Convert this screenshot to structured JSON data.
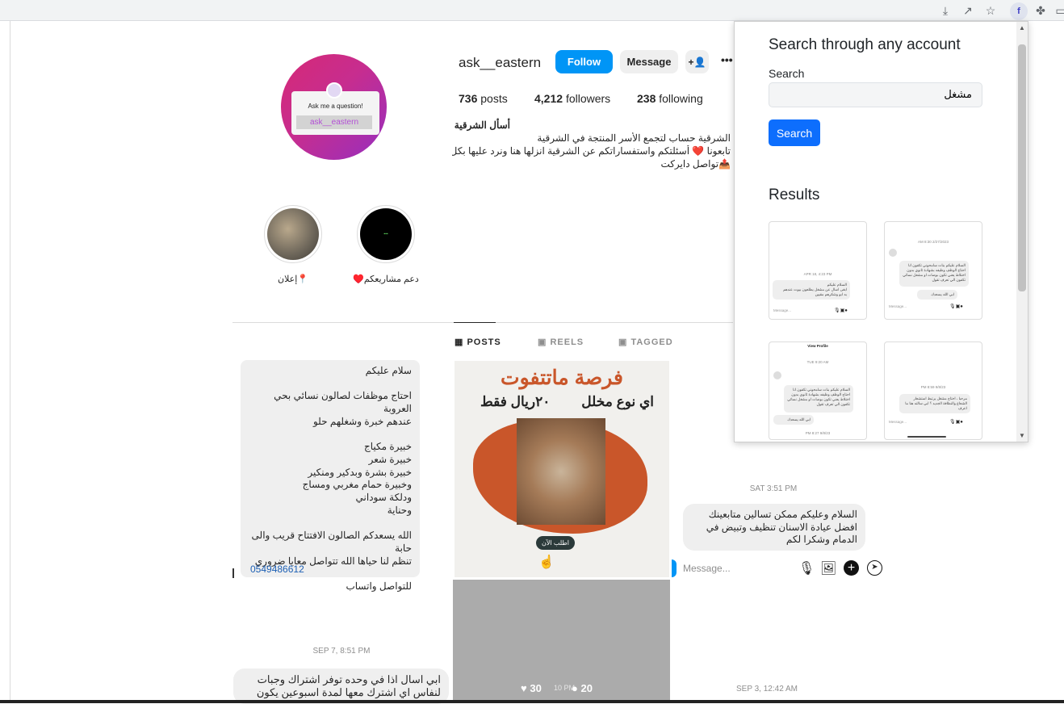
{
  "profile": {
    "username": "ask__eastern",
    "follow_label": "Follow",
    "message_label": "Message",
    "more_label": "•••",
    "posts_count": "736",
    "posts_label": "posts",
    "followers_count": "4,212",
    "followers_label": "followers",
    "following_count": "238",
    "following_label": "following",
    "display_name": "أسأل الشرقية",
    "bio_line1": "الشرقية حساب لتجمع الأسر المنتجة في الشرقية",
    "bio_line2": "تابعونا ❤️ أسئلتكم واستفساراتكم عن الشرقية انزلها هنا ونرد عليها بكل حب",
    "bio_line3": "📤تواصل دايركت",
    "avatar_caption": "Ask me a question!",
    "avatar_tag": "ask__eastern"
  },
  "highlights": [
    {
      "label": "📍إعلان"
    },
    {
      "label": "دعم مشاريعكم♥️"
    }
  ],
  "tabs": [
    {
      "label": "POSTS",
      "icon": "grid-icon"
    },
    {
      "label": "REELS",
      "icon": "reels-icon"
    },
    {
      "label": "TAGGED",
      "icon": "tagged-icon"
    }
  ],
  "posts": {
    "post1_text": "سلام عليكم\n\nاحتاج موظفات لصالون نسائي بحي العروبة\nعندهم خبرة وشغلهم حلو\n\nخبيرة مكياج\nخبيرة شعر\nخبيرة بشرة وبدكير ومنكير\nوخبيرة حمام مغربي ومساج\nودلكة سوداني\nوحناية\n\nالله يسعدكم الصالون الافتتاح قريب والى حابة\nتنظم لنا حياها الله  تتواصل معايا ضروري\n\nللتواصل واتساب",
    "post1_phone": "0549486612",
    "promo_title": "فرصة ماتتفوت",
    "promo_sub1": "اي نوع مخلل",
    "promo_sub2": "٢٠ريال فقط",
    "promo_button": "اطلب الآن",
    "post3_time": "SAT 3:51 PM",
    "post3_text": "السلام وعليكم ممكن تسالين متابعينك افضل عيادة الاسنان  تنظيف وتبيض في الدمام وشكرا لكم",
    "message_placeholder": "Message...",
    "post4_time": "SEP 7, 8:51 PM",
    "post4_text": "ابي اسال اذا في وحده توفر اشتراك وجبات لنفاس اي اشترك معها لمدة اسبوعين  يكون",
    "overlay_likes": "30",
    "overlay_comments": "20",
    "overlay_time": "10 PM",
    "post6_time": "SEP 3, 12:42 AM"
  },
  "popup": {
    "title": "Search through any account",
    "search_label": "Search",
    "search_value": "مشغل",
    "search_button": "Search",
    "results_heading": "Results",
    "results": [
      {
        "date": "APR 18, 4:23 PM",
        "text": "السلام عليكم\nابغى اسال عن مشغل يطلعون بيوت عندهم\nبه ابو وشكرهم مقيين",
        "placeholder": "Message..."
      },
      {
        "date": "2/27/2023 8:30 AM",
        "text": "السلام عليكم بنات سامحوني تكفون انا احتاج الوظف وظيفه بشهادة ثانوي بدون اختلاط يعني تكون بوصات او مشغل نسائي تكفون الي تعرف تقول",
        "reply": "ابي الله يسعدك",
        "placeholder": "Message..."
      },
      {
        "header": "View Profile",
        "date": "TUE 9:20 AM",
        "text": "السلام عليكم بنات سامحوني تكفون انا احتاج الوظف وظيفه بشهادة ثانوي بدون اختلاط يعني تكون بوصات او مشغل نسائي تكفون الي تعرف تقول",
        "reply": "ابي الله يسعدك",
        "footer": "9/8/23 8:27 PM"
      },
      {
        "date": "9/8/23 8:59 PM",
        "text": "مرحبا ، احتاج مشغل يرتبط استشعار الشعاع والنظافة الجديد ؟ ابي سالته هنا ما اعرف",
        "placeholder": "Message..."
      }
    ]
  },
  "colors": {
    "follow_blue": "#0095f6",
    "search_blue": "#0d6efd",
    "heart_red": "#e0245e",
    "promo_orange": "#c9562a"
  }
}
